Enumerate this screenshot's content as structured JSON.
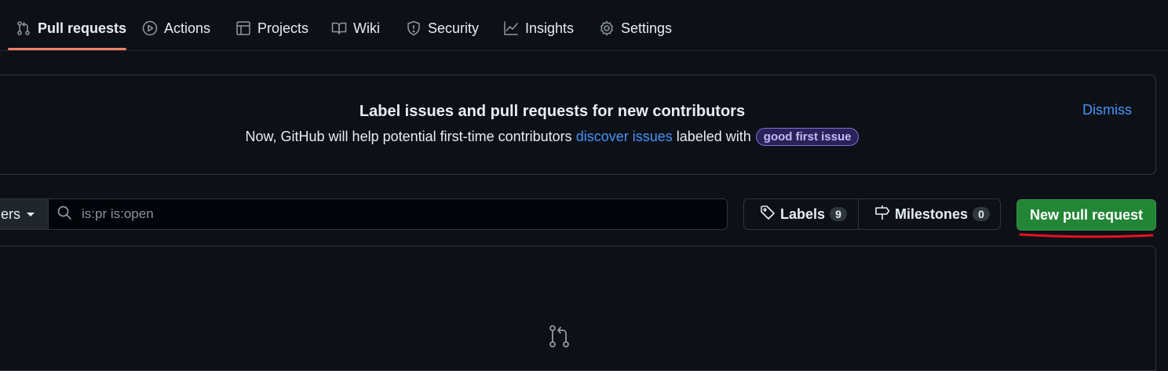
{
  "tabs": [
    {
      "label": "Pull requests",
      "icon": "git-pull-request-icon",
      "selected": true
    },
    {
      "label": "Actions",
      "icon": "play-icon"
    },
    {
      "label": "Projects",
      "icon": "table-icon"
    },
    {
      "label": "Wiki",
      "icon": "book-icon"
    },
    {
      "label": "Security",
      "icon": "shield-icon"
    },
    {
      "label": "Insights",
      "icon": "graph-icon"
    },
    {
      "label": "Settings",
      "icon": "gear-icon"
    }
  ],
  "banner": {
    "title": "Label issues and pull requests for new contributors",
    "text_before": "Now, GitHub will help potential first-time contributors",
    "link": "discover issues",
    "text_after": "labeled with",
    "label": "good first issue",
    "dismiss": "Dismiss"
  },
  "filters": {
    "button_label": "ers",
    "search_placeholder": "is:pr is:open"
  },
  "labels": {
    "label": "Labels",
    "count": "9"
  },
  "milestones": {
    "label": "Milestones",
    "count": "0"
  },
  "new_pr_button": "New pull request",
  "colors": {
    "accent_underline": "#f78166",
    "primary_button": "#238636",
    "link": "#4493f8",
    "annotation": "#e5141b"
  }
}
